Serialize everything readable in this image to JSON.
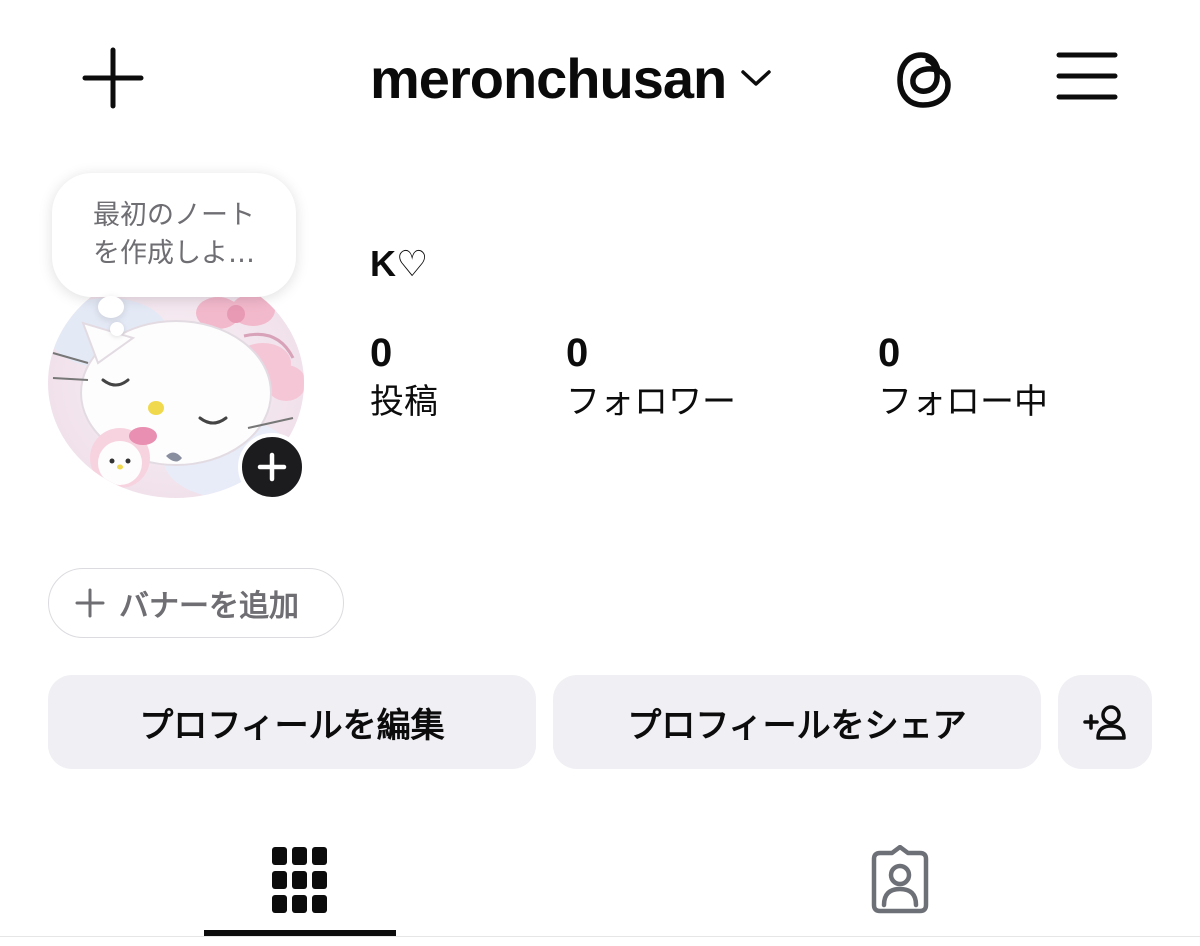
{
  "header": {
    "username": "meronchusan",
    "icons": {
      "create": "plus-icon",
      "switch_account": "chevron-down-icon",
      "threads": "threads-icon",
      "menu": "hamburger-menu-icon"
    }
  },
  "note": {
    "text": "最初のノート\nを作成しよ…"
  },
  "profile": {
    "display_name": "K♡",
    "avatar_icon": "profile-picture",
    "stats": [
      {
        "count": "0",
        "label": "投稿"
      },
      {
        "count": "0",
        "label": "フォロワー"
      },
      {
        "count": "0",
        "label": "フォロー中"
      }
    ]
  },
  "banner": {
    "label": "バナーを追加"
  },
  "actions": {
    "edit_profile": "プロフィールを編集",
    "share_profile": "プロフィールをシェア",
    "discover_people_icon": "add-person-icon"
  },
  "tabs": [
    {
      "icon": "grid-icon",
      "selected": true
    },
    {
      "icon": "tagged-person-icon",
      "selected": false
    }
  ],
  "colors": {
    "text": "#0c0c0c",
    "secondary_text": "#6e6e73",
    "button_bg": "#efeff4",
    "avatar_badge": "#1c1c1e"
  }
}
